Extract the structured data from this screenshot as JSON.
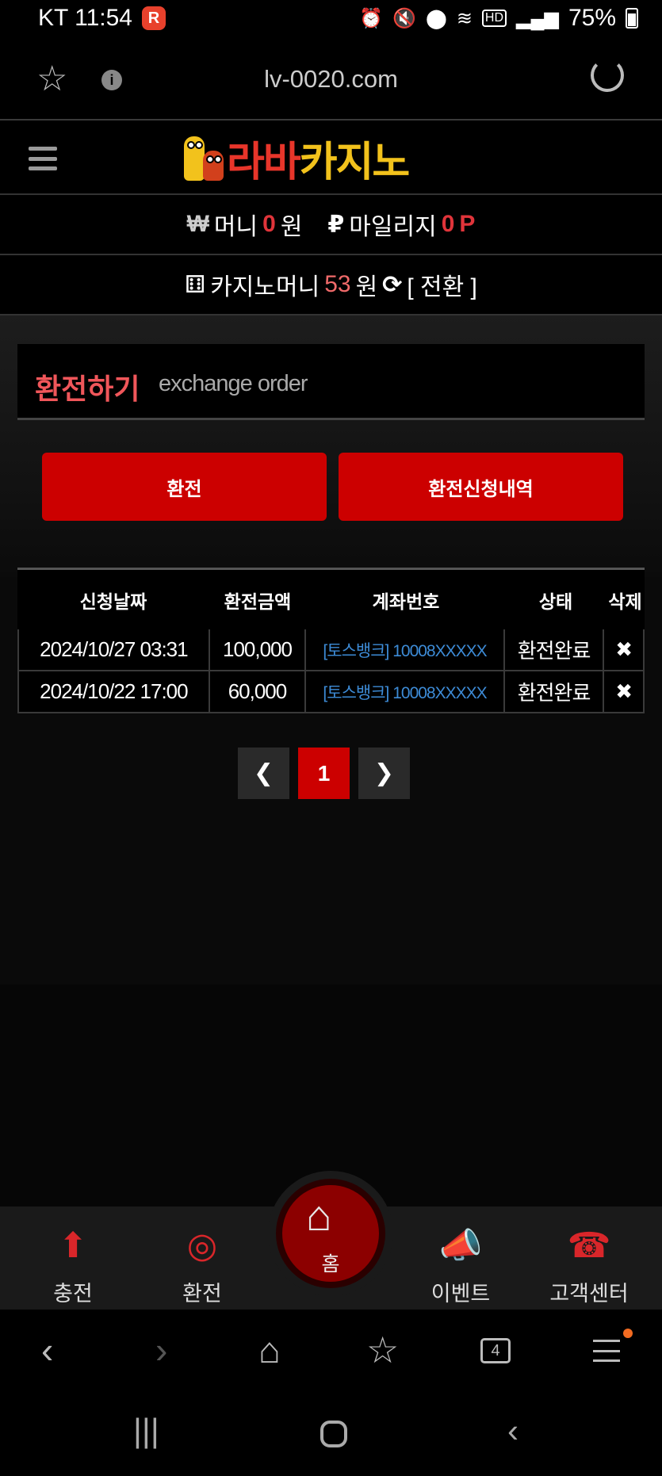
{
  "status_bar": {
    "carrier_time": "KT 11:54",
    "app_badge": "R",
    "battery": "75%",
    "icons": [
      "alarm-icon",
      "mute-icon",
      "location-icon",
      "wifi-icon",
      "hd-icon",
      "signal-icon",
      "battery-icon"
    ]
  },
  "browser": {
    "url": "lv-0020.com",
    "tabs_count": "4"
  },
  "site": {
    "logo_text_red": "라바",
    "logo_text_yellow": "카지노"
  },
  "money": {
    "won_symbol": "₩",
    "money_label": "머니",
    "money_value": "0",
    "money_unit": "원",
    "mileage_symbol": "₽",
    "mileage_label": "마일리지",
    "mileage_value": "0",
    "mileage_unit": "P",
    "casino_label": "카지노머니",
    "casino_value": "53",
    "casino_unit": "원",
    "convert_label": "[ 전환 ]"
  },
  "panel": {
    "title_ko": "환전하기",
    "title_en": "exchange order",
    "btn_exchange": "환전",
    "btn_history": "환전신청내역"
  },
  "table": {
    "headers": [
      "신청날짜",
      "환전금액",
      "계좌번호",
      "상태",
      "삭제"
    ],
    "rows": [
      {
        "date": "2024/10/27 03:31",
        "amount": "100,000",
        "account": "[토스뱅크] 10008XXXXX",
        "status": "환전완료",
        "delete": "✖"
      },
      {
        "date": "2024/10/22 17:00",
        "amount": "60,000",
        "account": "[토스뱅크] 10008XXXXX",
        "status": "환전완료",
        "delete": "✖"
      }
    ]
  },
  "pagination": {
    "current": "1"
  },
  "bottom_nav": {
    "charge": "충전",
    "exchange": "환전",
    "home": "홈",
    "event": "이벤트",
    "support": "고객센터"
  },
  "colors": {
    "accent_red": "#cc0000",
    "title_red": "#f0565a",
    "account_blue": "#3d8bd6",
    "logo_yellow": "#f2c21c"
  }
}
